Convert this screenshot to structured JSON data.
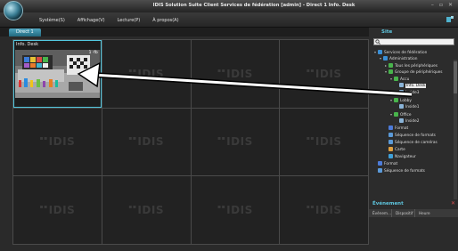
{
  "window": {
    "title": "IDIS Solution Suite Client Services de fédération [admin] - Direct 1  Info. Desk",
    "controls": [
      "–",
      "▫",
      "✕"
    ]
  },
  "menu": {
    "items": [
      "Système(S)",
      "Affichage(V)",
      "Lecture(P)",
      "À propos(A)"
    ]
  },
  "tabs": [
    {
      "label": "Direct 1",
      "active": true
    }
  ],
  "grid": {
    "rows": 3,
    "cols": 4,
    "watermark": "IDIS",
    "active_cell": {
      "title": "Info. Desk",
      "badge": "1 ·fb"
    }
  },
  "sidebar": {
    "site_title": "Site",
    "search_placeholder": "",
    "tree": [
      {
        "label": "Services de fédération",
        "icon": "globe-icon",
        "depth": 0,
        "expanded": true
      },
      {
        "label": "Administration",
        "icon": "globe-icon",
        "depth": 1,
        "expanded": true
      },
      {
        "label": "Tous les périphériques",
        "icon": "camera-group-icon",
        "depth": 2,
        "expanded": false
      },
      {
        "label": "Groupe de périphériques",
        "icon": "group-icon",
        "depth": 2,
        "expanded": true
      },
      {
        "label": "Accu",
        "icon": "group-icon",
        "depth": 3,
        "expanded": true
      },
      {
        "label": "Info. Desk",
        "icon": "camera-icon",
        "depth": 4,
        "selected": true
      },
      {
        "label": "Inside3",
        "icon": "camera-icon",
        "depth": 4
      },
      {
        "label": "Lobby",
        "icon": "group-icon",
        "depth": 3,
        "expanded": true
      },
      {
        "label": "Inside1",
        "icon": "camera-icon",
        "depth": 4
      },
      {
        "label": "Office",
        "icon": "group-icon",
        "depth": 3,
        "expanded": true
      },
      {
        "label": "Inside2",
        "icon": "camera-icon",
        "depth": 4
      },
      {
        "label": "Format",
        "icon": "layout-icon",
        "depth": 2
      },
      {
        "label": "Séquence de formats",
        "icon": "sequence-icon",
        "depth": 2
      },
      {
        "label": "Séquence de caméras",
        "icon": "sequence-icon",
        "depth": 2
      },
      {
        "label": "Carte",
        "icon": "map-icon",
        "depth": 2
      },
      {
        "label": "Navigateur",
        "icon": "browser-icon",
        "depth": 2
      },
      {
        "label": "Format",
        "icon": "layout-icon",
        "depth": 0
      },
      {
        "label": "Séquence de formats",
        "icon": "sequence-icon",
        "depth": 0
      }
    ]
  },
  "events": {
    "title": "Événement",
    "columns": [
      "Événem...",
      "Dispositif",
      "Heure"
    ]
  },
  "colors": {
    "accent": "#52c8e0",
    "tab": "#2f86a0",
    "arrow": "#ffffff"
  }
}
